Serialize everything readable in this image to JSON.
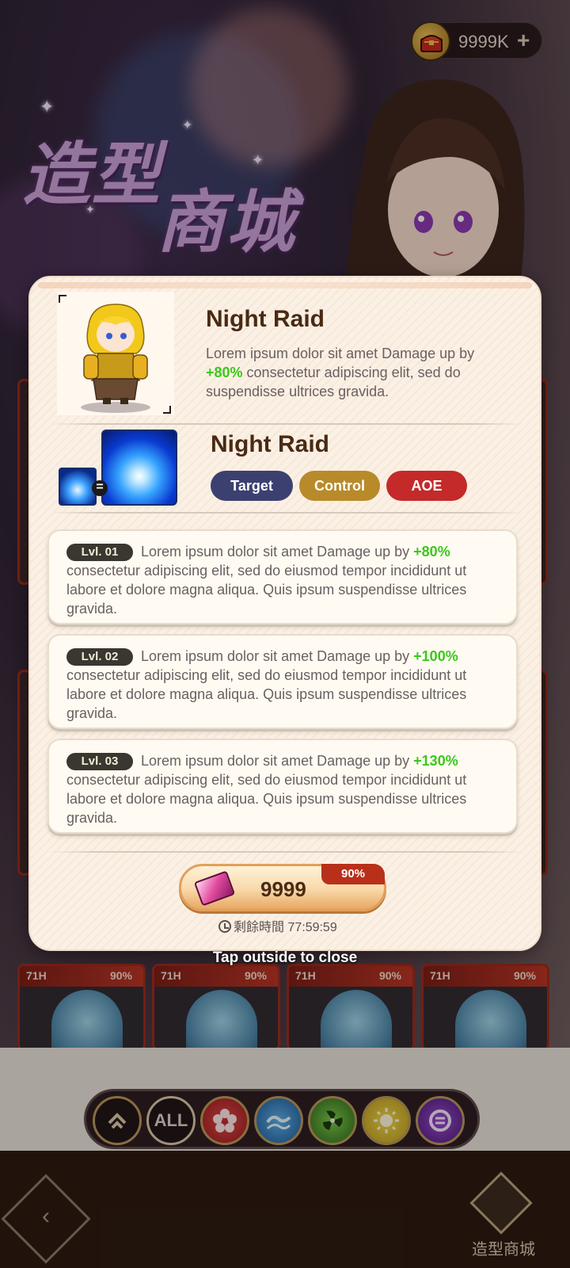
{
  "header": {
    "currency_value": "9999K",
    "currency_plus": "+",
    "currency_icon": "treasure-chest-icon",
    "title_art_line1": "造型",
    "title_art_line2": "商城"
  },
  "modal": {
    "skin": {
      "name": "Night Raid",
      "desc_before": "Lorem ipsum dolor sit amet Damage up by ",
      "desc_highlight": "+80%",
      "desc_after": " consectetur adipiscing elit, sed do suspendisse ultrices gravida."
    },
    "skill": {
      "name": "Night Raid",
      "tags": [
        "Target",
        "Control",
        "AOE"
      ]
    },
    "levels": [
      {
        "badge": "Lvl. 01",
        "text_before": "Lorem ipsum dolor sit amet Damage up by ",
        "highlight": "+80%",
        "text_after": " consectetur adipiscing elit, sed do eiusmod tempor incididunt ut labore et dolore magna aliqua. Quis ipsum suspendisse ultrices gravida."
      },
      {
        "badge": "Lvl. 02",
        "text_before": "Lorem ipsum dolor sit amet Damage up by ",
        "highlight": "+100%",
        "text_after": " consectetur adipiscing elit, sed do eiusmod tempor incididunt ut labore et dolore magna aliqua. Quis ipsum suspendisse ultrices gravida."
      },
      {
        "badge": "Lvl. 03",
        "text_before": "Lorem ipsum dolor sit amet Damage up by ",
        "highlight": "+130%",
        "text_after": " consectetur adipiscing elit, sed do eiusmod tempor incididunt ut labore et dolore magna aliqua. Quis ipsum suspendisse ultrices gravida."
      }
    ],
    "buy": {
      "price": "9999",
      "discount": "90%",
      "timer": "剩餘時間 77:59:59"
    }
  },
  "close_hint": "Tap outside to close",
  "shop_cards": [
    {
      "time": "71H",
      "discount": "90%"
    },
    {
      "time": "71H",
      "discount": "90%"
    },
    {
      "time": "71H",
      "discount": "90%"
    },
    {
      "time": "71H",
      "discount": "90%"
    }
  ],
  "filters": {
    "all_label": "ALL",
    "icons": [
      "rank-up-icon",
      "all-filter",
      "flower-element-icon",
      "water-element-icon",
      "wind-element-icon",
      "light-element-icon",
      "dark-element-icon"
    ]
  },
  "footer": {
    "shop_label": "造型商城"
  },
  "colors": {
    "highlight_green": "#3ac81a",
    "tag_target": "#3c4070",
    "tag_control": "#b88a2a",
    "tag_aoe": "#c42a2a"
  }
}
